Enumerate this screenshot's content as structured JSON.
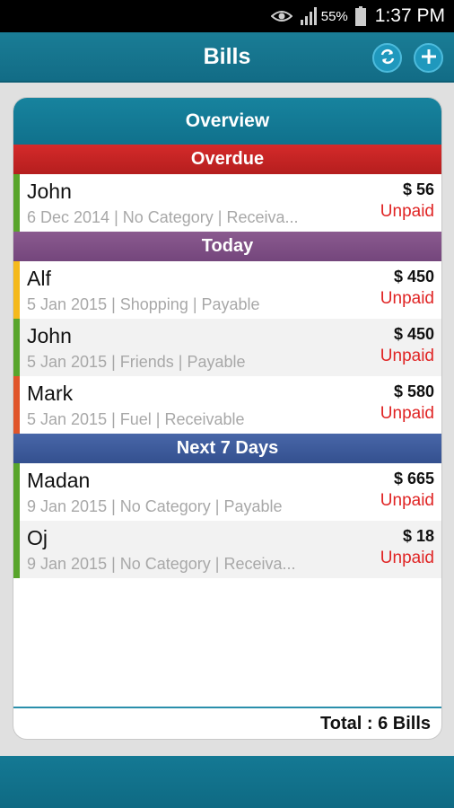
{
  "status_bar": {
    "battery": "55%",
    "time": "1:37 PM"
  },
  "app_bar": {
    "title": "Bills",
    "sync_icon": "sync-icon",
    "add_icon": "plus-icon"
  },
  "card": {
    "title": "Overview"
  },
  "sections": {
    "overdue": {
      "title": "Overdue",
      "bills": [
        {
          "name": "John",
          "meta": "6 Dec 2014 | No Category | Receiva...",
          "amount": "$ 56",
          "status": "Unpaid",
          "color": "#58a52b"
        }
      ]
    },
    "today": {
      "title": "Today",
      "bills": [
        {
          "name": "Alf",
          "meta": "5 Jan 2015 | Shopping | Payable",
          "amount": "$ 450",
          "status": "Unpaid",
          "color": "#f5b91b"
        },
        {
          "name": "John",
          "meta": "5 Jan 2015 | Friends | Payable",
          "amount": "$ 450",
          "status": "Unpaid",
          "color": "#58a52b"
        },
        {
          "name": "Mark",
          "meta": "5 Jan 2015 | Fuel | Receivable",
          "amount": "$ 580",
          "status": "Unpaid",
          "color": "#e0552a"
        }
      ]
    },
    "next7": {
      "title": "Next 7 Days",
      "bills": [
        {
          "name": "Madan",
          "meta": "9 Jan 2015 | No Category | Payable",
          "amount": "$ 665",
          "status": "Unpaid",
          "color": "#58a52b"
        },
        {
          "name": "Oj",
          "meta": "9 Jan 2015 | No Category | Receiva...",
          "amount": "$ 18",
          "status": "Unpaid",
          "color": "#58a52b"
        }
      ]
    }
  },
  "footer": {
    "total": "Total : 6 Bills"
  },
  "colors": {
    "primary": "#12758f",
    "overdue": "#c62424",
    "today": "#7e5086",
    "next7": "#3e5b9c",
    "unpaid": "#e02424"
  }
}
